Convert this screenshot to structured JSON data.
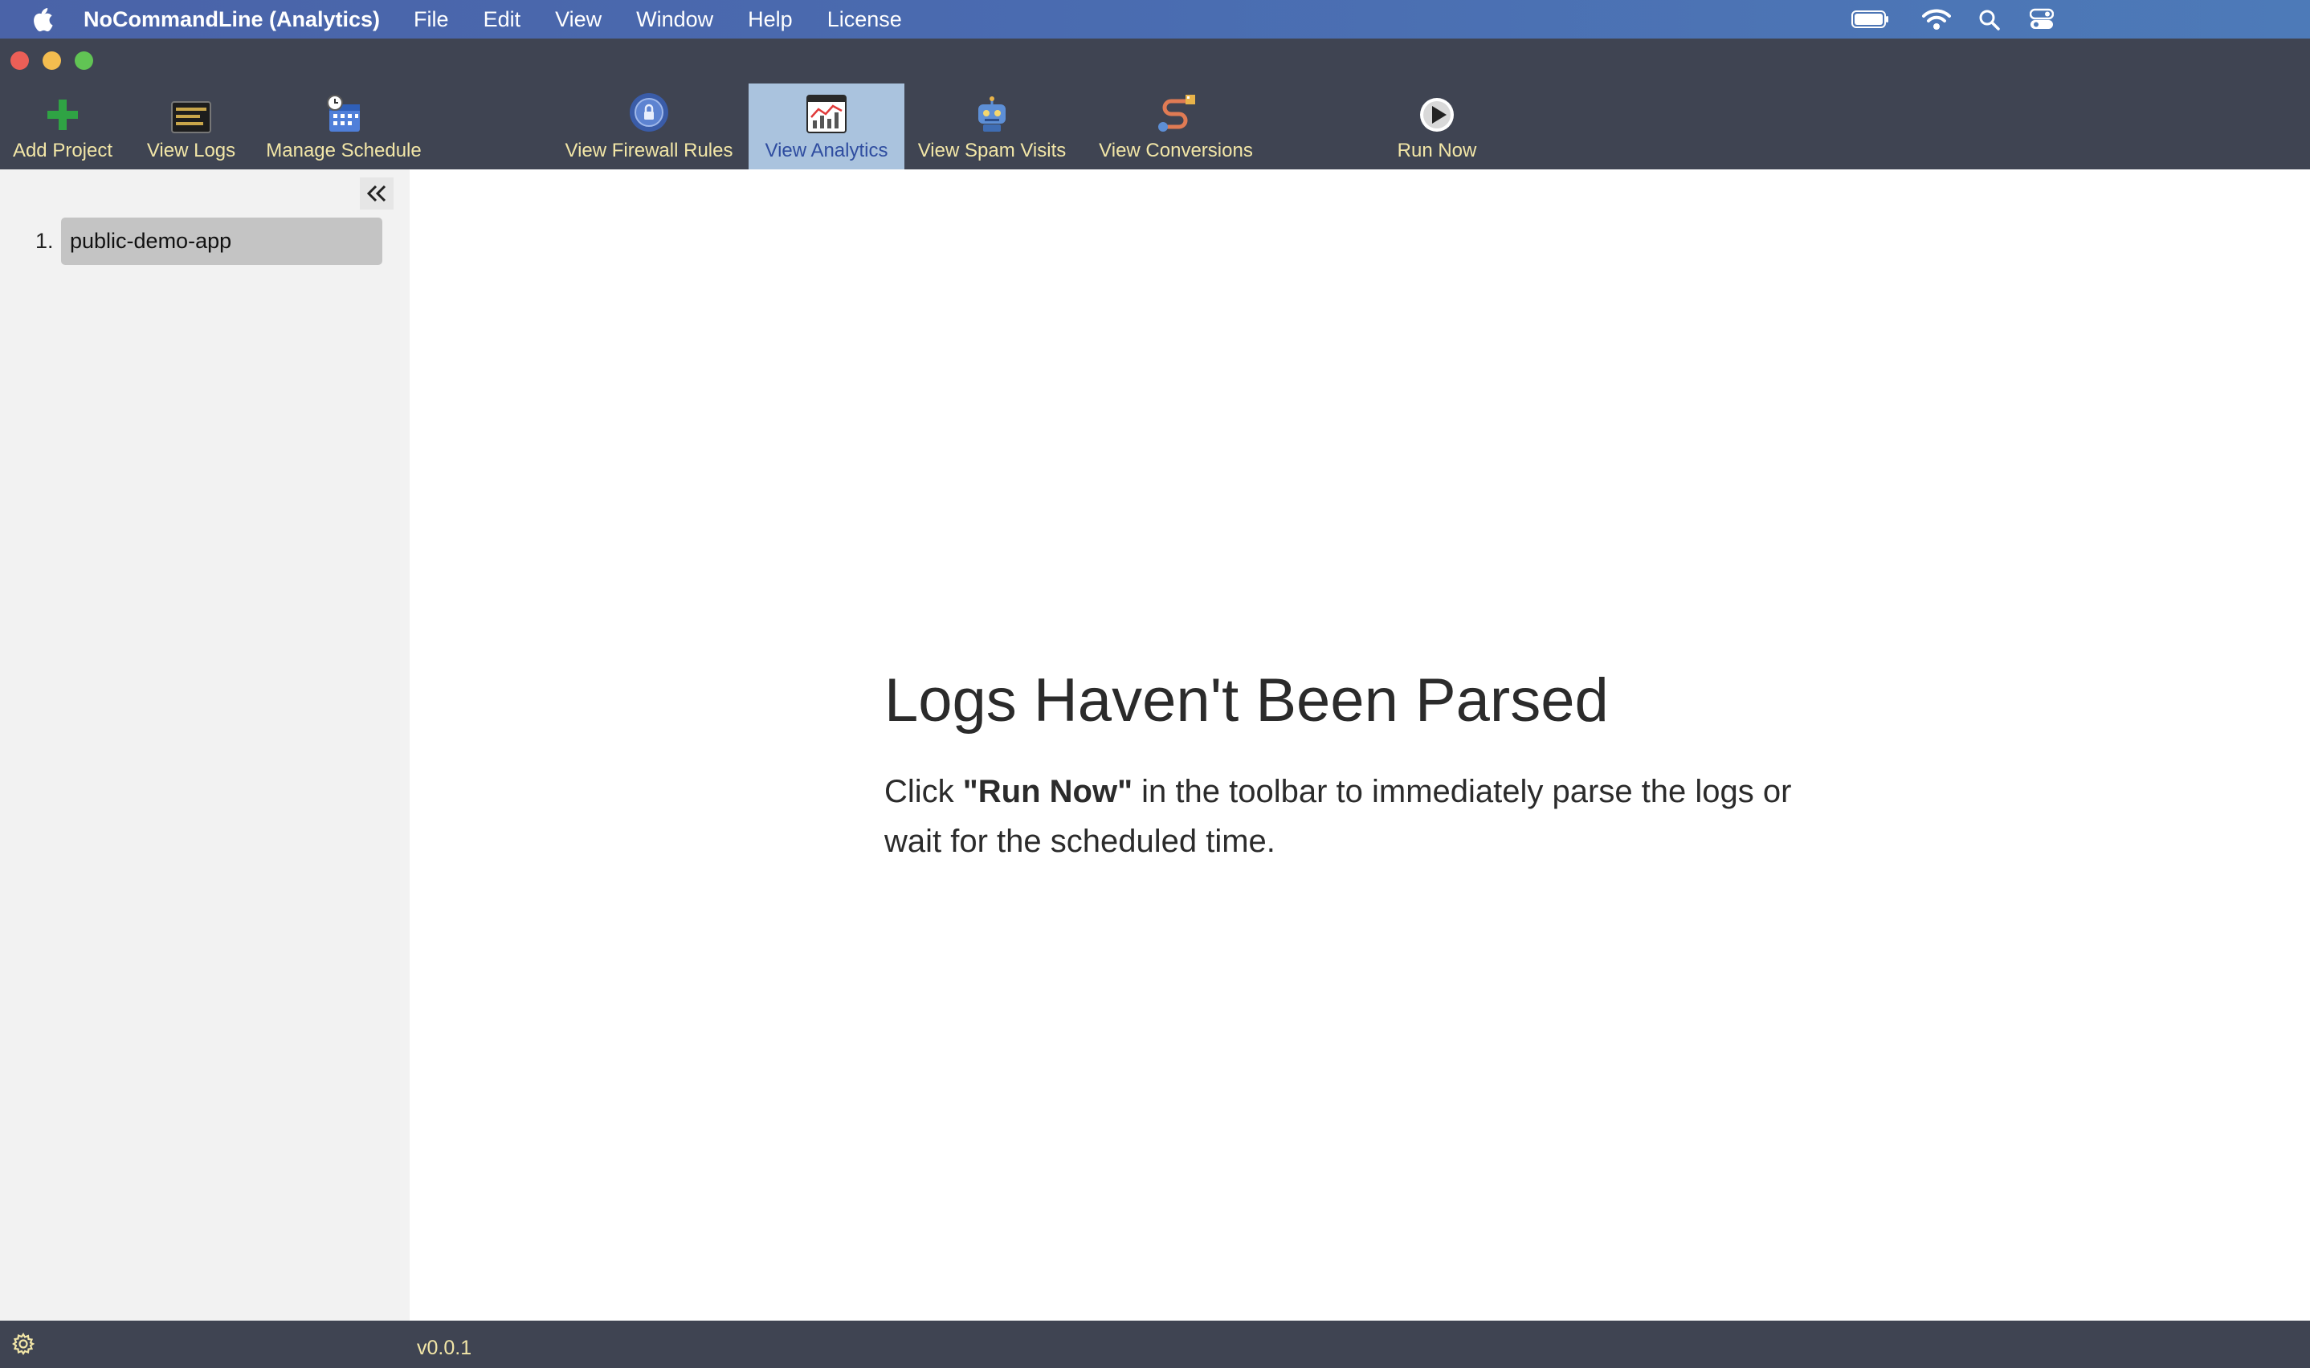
{
  "menubar": {
    "app_name": "NoCommandLine (Analytics)",
    "items": [
      "File",
      "Edit",
      "View",
      "Window",
      "Help",
      "License"
    ]
  },
  "toolbar": {
    "add_project": "Add Project",
    "view_logs": "View Logs",
    "manage_schedule": "Manage Schedule",
    "view_firewall_rules": "View Firewall Rules",
    "view_analytics": "View Analytics",
    "view_spam_visits": "View Spam Visits",
    "view_conversions": "View Conversions",
    "run_now": "Run Now",
    "active": "View Analytics"
  },
  "sidebar": {
    "projects": [
      {
        "number": "1.",
        "name": "public-demo-app"
      }
    ]
  },
  "main": {
    "title": "Logs Haven't Been Parsed",
    "message_prefix": "Click",
    "message_bold": "\"Run Now\"",
    "message_suffix": "in the toolbar to immediately parse the logs or wait for the scheduled time."
  },
  "footer": {
    "version": "v0.0.1"
  },
  "colors": {
    "toolbar_bg": "#3f4452",
    "toolbar_text": "#f2e6a7",
    "active_tab_bg": "#aac3de",
    "active_tab_text": "#2f4da0",
    "sidebar_bg": "#f2f2f2"
  },
  "icons": {
    "menubar": [
      "apple-icon",
      "battery-icon",
      "wifi-icon",
      "spotlight-search-icon",
      "control-center-icon"
    ],
    "toolbar": [
      "plus-icon",
      "logs-icon",
      "calendar-clock-icon",
      "firewall-shield-icon",
      "analytics-chart-icon",
      "robot-icon",
      "conversion-path-icon",
      "play-icon"
    ],
    "other": [
      "double-chevron-left-icon",
      "gear-icon"
    ]
  }
}
